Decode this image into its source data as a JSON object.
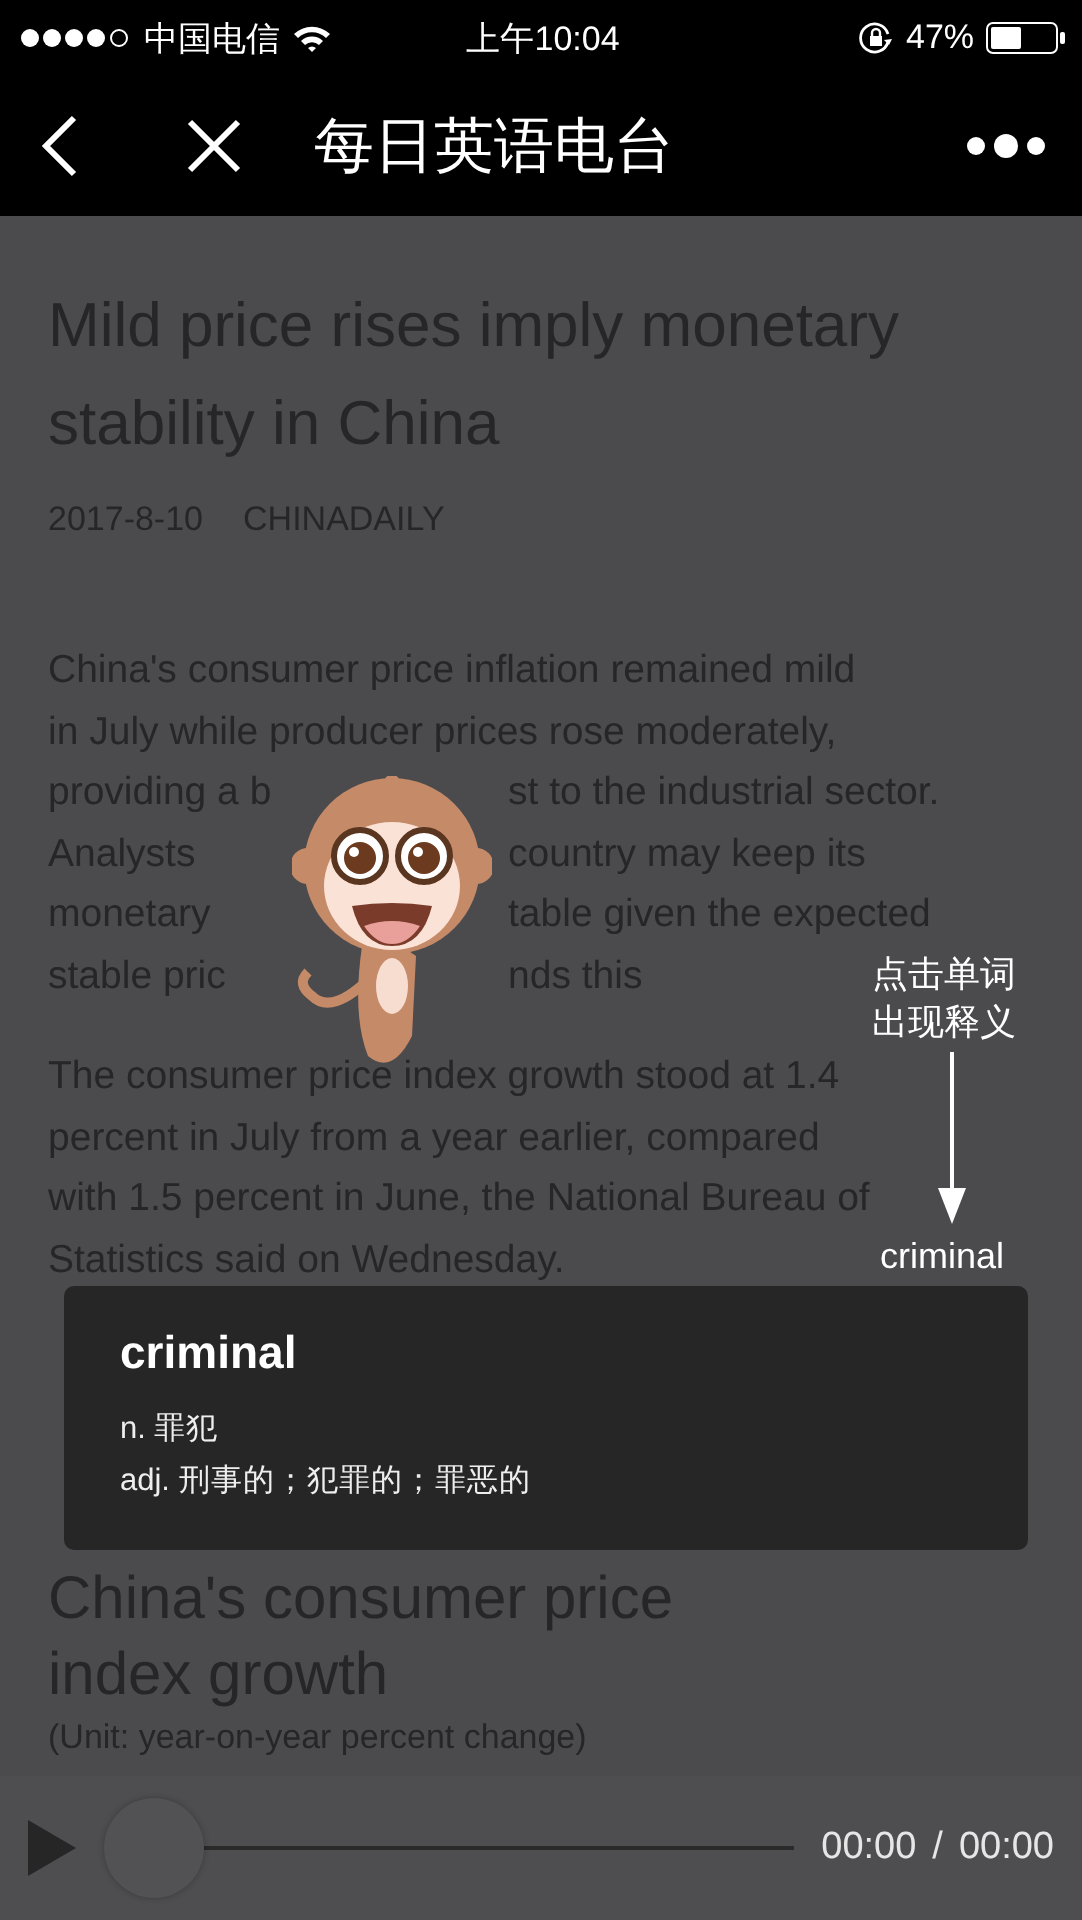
{
  "status_bar": {
    "carrier": "中国电信",
    "time": "上午10:04",
    "battery": "47%"
  },
  "nav": {
    "title": "每日英语电台"
  },
  "article": {
    "title": "Mild price rises imply monetary stability in China",
    "date": "2017-8-10",
    "source": "CHINADAILY",
    "paragraphs": [
      {
        "lines": [
          [
            "China's consumer price inflation remained mild"
          ],
          [
            "in July while producer prices rose moderately,"
          ],
          [
            "providing a b",
            "st to the industrial sector."
          ],
          [
            "Analysts",
            "country may keep its"
          ],
          [
            "monetary",
            "table given the expected"
          ],
          [
            "stable pric",
            "nds this"
          ]
        ]
      },
      {
        "lines": [
          [
            "The consumer price index growth stood at 1.4"
          ],
          [
            "percent in July from a year earlier, compared"
          ],
          [
            "with 1.5 percent in June, the National Bureau of"
          ],
          [
            "Statistics said on Wednesday."
          ]
        ]
      }
    ],
    "chart_title_lines": [
      "China's consumer price",
      "index growth"
    ],
    "chart_unit": "(Unit: year-on-year percent change)"
  },
  "hint": {
    "text_lines": [
      "点击单词",
      "出现释义"
    ],
    "word": "criminal"
  },
  "popup": {
    "word": "criminal",
    "definitions": [
      "n. 罪犯",
      "adj. 刑事的；犯罪的；罪恶的"
    ]
  },
  "player": {
    "current": "00:00",
    "separator": "/",
    "total": "00:00",
    "level": 0
  }
}
